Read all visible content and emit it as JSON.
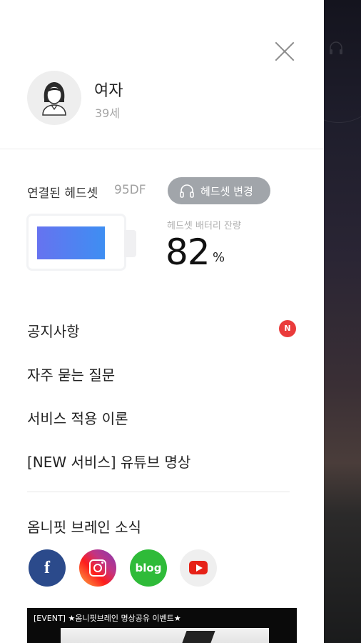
{
  "profile": {
    "name": "여자",
    "age": "39세",
    "avatar_icon": "woman-avatar-icon"
  },
  "headset": {
    "label": "연결된 헤드셋",
    "model": "95DF",
    "change_button_label": "헤드셋 변경",
    "battery_label": "헤드셋 배터리 잔량",
    "battery_value": "82",
    "battery_unit": "%",
    "battery_level_percent": 82
  },
  "menu": {
    "items": [
      {
        "label": "공지사항",
        "badge": "N"
      },
      {
        "label": "자주 묻는 질문"
      },
      {
        "label": "서비스 적용 이론"
      },
      {
        "label": "[NEW 서비스] 유튜브 명상"
      }
    ]
  },
  "news": {
    "title": "옴니핏 브레인 소식",
    "social": [
      {
        "name": "facebook",
        "glyph": "f",
        "color": "#2b4a8b"
      },
      {
        "name": "instagram",
        "color": "#c13584"
      },
      {
        "name": "blog",
        "glyph": "blog",
        "color": "#2fbb39"
      },
      {
        "name": "youtube",
        "color": "#e62117"
      }
    ]
  },
  "banner": {
    "text": "[EVENT] ★옴니핏브레인 명상공유 이벤트★"
  },
  "colors": {
    "badge": "#ea3b3b",
    "button": "#a1a5aa",
    "battery_start": "#6673f0",
    "battery_end": "#3e8ef2"
  }
}
